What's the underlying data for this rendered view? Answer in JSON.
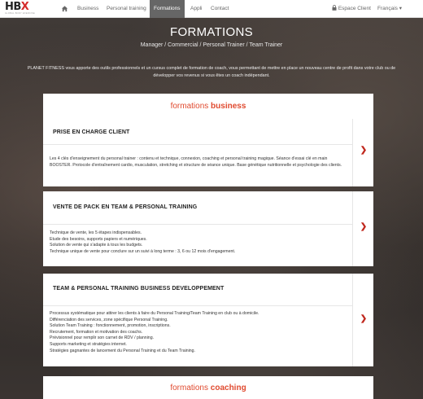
{
  "nav": {
    "logo_text": "HBX",
    "logo_sub": "GLOBAL BODY EXERCISE",
    "items": [
      "Business",
      "Personal training",
      "Formations",
      "Appli",
      "Contact"
    ],
    "active": "Formations",
    "espace_client": "Espace Client",
    "language": "Français ▾"
  },
  "hero": {
    "title": "FORMATIONS",
    "subtitle": "Manager / Commercial / Personal Trainer / Team Trainer",
    "description": "PLANET FITNESS vous apporte des outils professionnels et un cursus complet de formation de coach, vous permettant de mettre en place un nouveau centre de profit dans votre club ou de développer vos revenus si vous êtes un coach indépendant."
  },
  "section_business": {
    "prefix": "formations ",
    "bold": "business"
  },
  "section_coaching": {
    "prefix": "formations ",
    "bold": "coaching"
  },
  "cards": [
    {
      "title": "PRISE EN CHARGE CLIENT",
      "body": [
        "Les 4 clés d'enseignement du personal trainer : contenu et technique, connexion, coaching et personal training magique. Séance d'essai clé en main BOOSTER. Protocole d'entraînement cardio, musculation, stretching et structure de séance unique. Base génétique nutritionnelle et psychologie des clients."
      ]
    },
    {
      "title": "VENTE DE PACK EN TEAM & PERSONAL TRAINING",
      "body": [
        "Technique de vente, les 5 étapes indispensables.",
        "Etude des besoins, supports papiers et numériques.",
        "Solution de vente qui s'adapte à tous les budgets.",
        "Technique unique de vente pour conclure sur un suivi à long terme : 3, 6 ou 12 mois d'engagement."
      ]
    },
    {
      "title": "TEAM & PERSONAL TRAINING BUSINESS DEVELOPPEMENT",
      "body": [
        "Processus systématique pour attirer les clients à faire du Personal Training/Team Training en club ou à domicile.",
        "Différenciation des services, zone spécifique Personal Training.",
        "Solution Team Training : fonctionnement, promotion, inscriptions.",
        "Recrutement, formation et motivation des coachs.",
        "Prévisionnel pour remplir son carnet de RDV / planning.",
        "Supports marketing et stratégies internet.",
        "Stratégies gagnantes de lancement du Personal Training et du Team Training."
      ]
    }
  ],
  "arrow_glyph": "❯",
  "colors": {
    "accent": "#e04a2f",
    "arrow": "#c0281e",
    "nav_active_bg": "#666666"
  },
  "icons": [
    "home-icon",
    "lock-icon",
    "chevron-right-icon"
  ]
}
